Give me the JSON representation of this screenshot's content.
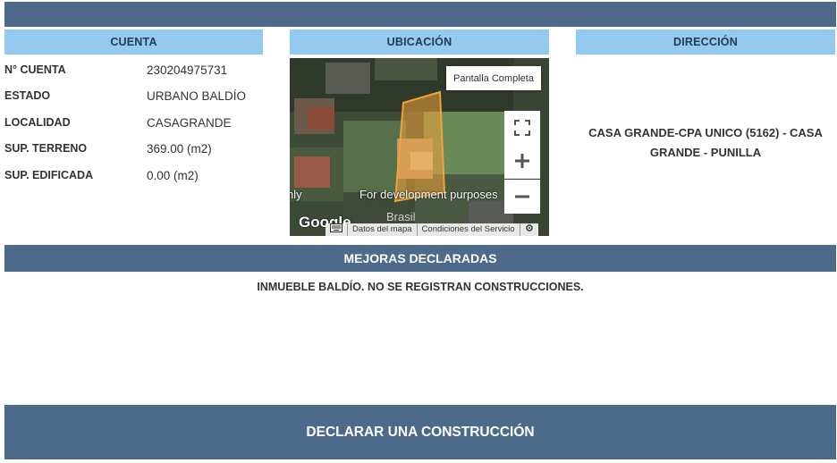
{
  "headers": {
    "cuenta": "CUENTA",
    "ubicacion": "UBICACIÓN",
    "direccion": "DIRECCIÓN"
  },
  "cuenta": [
    {
      "label": "N° CUENTA",
      "value": "230204975731"
    },
    {
      "label": "ESTADO",
      "value": "URBANO BALDÍO"
    },
    {
      "label": "LOCALIDAD",
      "value": "CASAGRANDE"
    },
    {
      "label": "SUP. TERRENO",
      "value": "369.00 (m2)"
    },
    {
      "label": "SUP. EDIFICADA",
      "value": "0.00 (m2)"
    }
  ],
  "map": {
    "fullscreen_label": "Pantalla Completa",
    "dev_text_left": "nly",
    "dev_text_right": "For development purposes",
    "logo_text": "Google",
    "place_label": "Brasil",
    "attribution": {
      "map_data": "Datos del mapa",
      "terms": "Condiciones del Servicio"
    },
    "icons": [
      "fullscreen-icon",
      "zoom-in-icon",
      "zoom-out-icon",
      "keyboard-icon",
      "settings-icon"
    ]
  },
  "direccion": {
    "text": "CASA GRANDE-CPA UNICO (5162) - CASA GRANDE - PUNILLA"
  },
  "mejoras": {
    "title": "MEJORAS DECLARADAS",
    "text": "INMUEBLE BALDÍO. NO SE REGISTRAN CONSTRUCCIONES."
  },
  "declarar_label": "DECLARAR UNA CONSTRUCCIÓN",
  "colors": {
    "bar": "#4e6a8a",
    "header": "#94c9f0",
    "parcel": "#f2a23a"
  }
}
